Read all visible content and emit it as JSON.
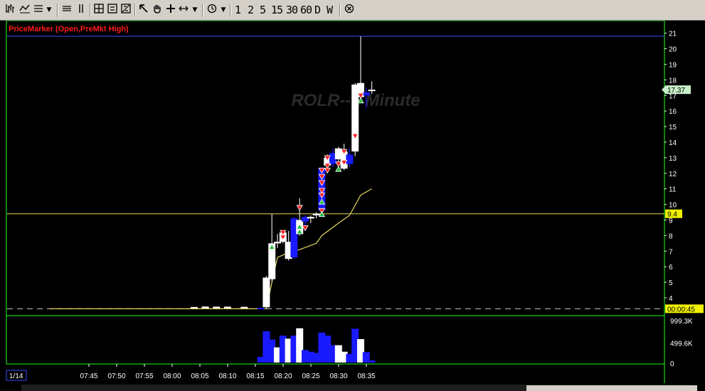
{
  "toolbar": {
    "icons": [
      "bars-icon",
      "chart-style-icon",
      "lines-icon",
      "dropdown-icon",
      "horizontal-lines-icon",
      "vertical-lines-icon",
      "zoom-box-icon",
      "zoom-in-icon",
      "zoom-out-icon",
      "pointer-icon",
      "pan-icon",
      "crosshair-icon",
      "horizontal-arrow-icon",
      "dropdown-icon",
      "clock-icon",
      "dropdown-icon",
      "close-icon"
    ],
    "periods": [
      "1",
      "2",
      "5",
      "15",
      "30",
      "60",
      "D",
      "W"
    ]
  },
  "chart_data": {
    "type": "candlestick",
    "title": "ROLR--1 Minute",
    "indicator_label": "PriceMarker (Open,PreMkt High)",
    "colors": {
      "up": "#ffffff",
      "down": "#1a1aff",
      "volume_up": "#ffffff",
      "volume_down": "#1a1aff",
      "avg": "#e6d860",
      "marker_line": "#e6d860",
      "top_line": "#3050ff",
      "sell_signal": "#ff2020",
      "buy_signal": "#20c040",
      "grid": "#1a1a1a",
      "panel_border": "#1aff1a"
    },
    "ylim": [
      3.45,
      21.35
    ],
    "y_ticks": [
      4,
      5,
      6,
      7,
      8,
      9,
      10,
      11,
      12,
      13,
      14,
      15,
      16,
      17,
      18,
      19,
      20,
      21
    ],
    "x_ticks": [
      "07:45",
      "07:50",
      "07:55",
      "08:00",
      "08:05",
      "08:10",
      "08:15",
      "08:20",
      "08:25",
      "08:30",
      "08:35"
    ],
    "date_label": "1/14",
    "last_price_label": "17.37",
    "last_price": 17.37,
    "premarket_high_label": "9.4",
    "premarket_high": 9.4,
    "top_line_value": 20.8,
    "baseline_value": 3.3,
    "timer_label": "00:00:45",
    "volume_axis": [
      "999.3K",
      "499.6K",
      "0"
    ],
    "volume_max": 999300,
    "time_start": "07:39",
    "minutes_per_bar": 1,
    "candles": [
      {
        "t": "08:17",
        "o": 3.35,
        "h": 3.35,
        "l": 3.3,
        "c": 3.3
      },
      {
        "t": "08:18",
        "o": 3.4,
        "h": 5.4,
        "l": 3.35,
        "c": 5.3
      },
      {
        "t": "08:19",
        "o": 5.2,
        "h": 9.4,
        "l": 5.0,
        "c": 7.5
      },
      {
        "t": "08:20",
        "o": 7.5,
        "h": 8.1,
        "l": 7.2,
        "c": 7.6
      },
      {
        "t": "08:21",
        "o": 7.6,
        "h": 8.2,
        "l": 7.5,
        "c": 8.2
      },
      {
        "t": "08:22",
        "o": 6.5,
        "h": 8.3,
        "l": 6.4,
        "c": 7.6
      },
      {
        "t": "08:23",
        "o": 9.1,
        "h": 9.2,
        "l": 6.5,
        "c": 6.6
      },
      {
        "t": "08:24",
        "o": 8.1,
        "h": 10.4,
        "l": 8.0,
        "c": 9.0
      },
      {
        "t": "08:25",
        "o": 9.2,
        "h": 9.3,
        "l": 8.3,
        "c": 8.9
      },
      {
        "t": "08:26",
        "o": 9.1,
        "h": 9.3,
        "l": 8.8,
        "c": 9.2
      },
      {
        "t": "08:27",
        "o": 9.3,
        "h": 9.5,
        "l": 9.1,
        "c": 9.4
      },
      {
        "t": "08:28",
        "o": 12.3,
        "h": 12.4,
        "l": 9.3,
        "c": 9.6
      },
      {
        "t": "08:29",
        "o": 12.5,
        "h": 13.2,
        "l": 12.0,
        "c": 13.0
      },
      {
        "t": "08:30",
        "o": 13.3,
        "h": 13.6,
        "l": 12.4,
        "c": 12.6
      },
      {
        "t": "08:31",
        "o": 12.9,
        "h": 13.7,
        "l": 12.6,
        "c": 13.6
      },
      {
        "t": "08:32",
        "o": 12.3,
        "h": 13.9,
        "l": 12.2,
        "c": 13.4
      },
      {
        "t": "08:33",
        "o": 13.2,
        "h": 13.6,
        "l": 12.4,
        "c": 12.6
      },
      {
        "t": "08:34",
        "o": 13.4,
        "h": 17.8,
        "l": 13.1,
        "c": 17.7
      },
      {
        "t": "08:35",
        "o": 16.9,
        "h": 20.8,
        "l": 16.6,
        "c": 17.8
      },
      {
        "t": "08:36",
        "o": 17.2,
        "h": 17.5,
        "l": 16.2,
        "c": 17.0
      },
      {
        "t": "08:37",
        "o": 17.3,
        "h": 17.9,
        "l": 17.1,
        "c": 17.37
      }
    ],
    "volume": [
      {
        "t": "08:17",
        "v": 130000,
        "up": false
      },
      {
        "t": "08:18",
        "v": 720000,
        "up": false
      },
      {
        "t": "08:19",
        "v": 530000,
        "up": false
      },
      {
        "t": "08:20",
        "v": 350000,
        "up": true
      },
      {
        "t": "08:21",
        "v": 620000,
        "up": false
      },
      {
        "t": "08:22",
        "v": 550000,
        "up": true
      },
      {
        "t": "08:23",
        "v": 620000,
        "up": false
      },
      {
        "t": "08:24",
        "v": 790000,
        "up": true
      },
      {
        "t": "08:25",
        "v": 290000,
        "up": false
      },
      {
        "t": "08:26",
        "v": 250000,
        "up": false
      },
      {
        "t": "08:27",
        "v": 220000,
        "up": false
      },
      {
        "t": "08:28",
        "v": 690000,
        "up": false
      },
      {
        "t": "08:29",
        "v": 620000,
        "up": false
      },
      {
        "t": "08:30",
        "v": 400000,
        "up": false
      },
      {
        "t": "08:31",
        "v": 400000,
        "up": true
      },
      {
        "t": "08:32",
        "v": 250000,
        "up": true
      },
      {
        "t": "08:33",
        "v": 200000,
        "up": false
      },
      {
        "t": "08:34",
        "v": 780000,
        "up": false
      },
      {
        "t": "08:35",
        "v": 540000,
        "up": true
      },
      {
        "t": "08:36",
        "v": 240000,
        "up": false
      },
      {
        "t": "08:37",
        "v": 50000,
        "up": false
      }
    ],
    "premarket_ticks": [
      {
        "t": "08:05",
        "v": 3.32
      },
      {
        "t": "08:07",
        "v": 3.35
      },
      {
        "t": "08:09",
        "v": 3.34
      },
      {
        "t": "08:11",
        "v": 3.34
      },
      {
        "t": "08:14",
        "v": 3.33
      }
    ],
    "average_line": [
      {
        "t": "07:39",
        "v": 3.3
      },
      {
        "t": "08:18",
        "v": 3.3
      },
      {
        "t": "08:19",
        "v": 5.0
      },
      {
        "t": "08:20",
        "v": 6.6
      },
      {
        "t": "08:22",
        "v": 6.9
      },
      {
        "t": "08:24",
        "v": 7.1
      },
      {
        "t": "08:27",
        "v": 7.5
      },
      {
        "t": "08:28",
        "v": 8.0
      },
      {
        "t": "08:31",
        "v": 8.8
      },
      {
        "t": "08:33",
        "v": 9.3
      },
      {
        "t": "08:35",
        "v": 10.6
      },
      {
        "t": "08:37",
        "v": 11.0
      }
    ],
    "signals": [
      {
        "t": "08:21",
        "v": 8.2,
        "kind": "sell"
      },
      {
        "t": "08:21",
        "v": 7.9,
        "kind": "sell"
      },
      {
        "t": "08:19",
        "v": 7.3,
        "kind": "buy"
      },
      {
        "t": "08:24",
        "v": 9.8,
        "kind": "sell"
      },
      {
        "t": "08:24",
        "v": 8.6,
        "kind": "buy"
      },
      {
        "t": "08:24",
        "v": 8.3,
        "kind": "buy"
      },
      {
        "t": "08:25",
        "v": 8.5,
        "kind": "sell"
      },
      {
        "t": "08:28",
        "v": 12.2,
        "kind": "sell"
      },
      {
        "t": "08:28",
        "v": 11.8,
        "kind": "sell"
      },
      {
        "t": "08:28",
        "v": 11.4,
        "kind": "sell"
      },
      {
        "t": "08:28",
        "v": 10.9,
        "kind": "sell"
      },
      {
        "t": "08:28",
        "v": 10.6,
        "kind": "sell"
      },
      {
        "t": "08:28",
        "v": 10.2,
        "kind": "buy"
      },
      {
        "t": "08:28",
        "v": 9.6,
        "kind": "sell"
      },
      {
        "t": "08:28",
        "v": 9.4,
        "kind": "buy"
      },
      {
        "t": "08:29",
        "v": 13.0,
        "kind": "sell"
      },
      {
        "t": "08:29",
        "v": 12.5,
        "kind": "sell"
      },
      {
        "t": "08:29",
        "v": 12.2,
        "kind": "sell"
      },
      {
        "t": "08:31",
        "v": 12.6,
        "kind": "sell"
      },
      {
        "t": "08:31",
        "v": 12.3,
        "kind": "buy"
      },
      {
        "t": "08:32",
        "v": 13.4,
        "kind": "sell"
      },
      {
        "t": "08:32",
        "v": 12.7,
        "kind": "sell"
      },
      {
        "t": "08:34",
        "v": 14.4,
        "kind": "sell"
      },
      {
        "t": "08:35",
        "v": 17.0,
        "kind": "sell"
      },
      {
        "t": "08:35",
        "v": 16.7,
        "kind": "buy"
      }
    ]
  }
}
